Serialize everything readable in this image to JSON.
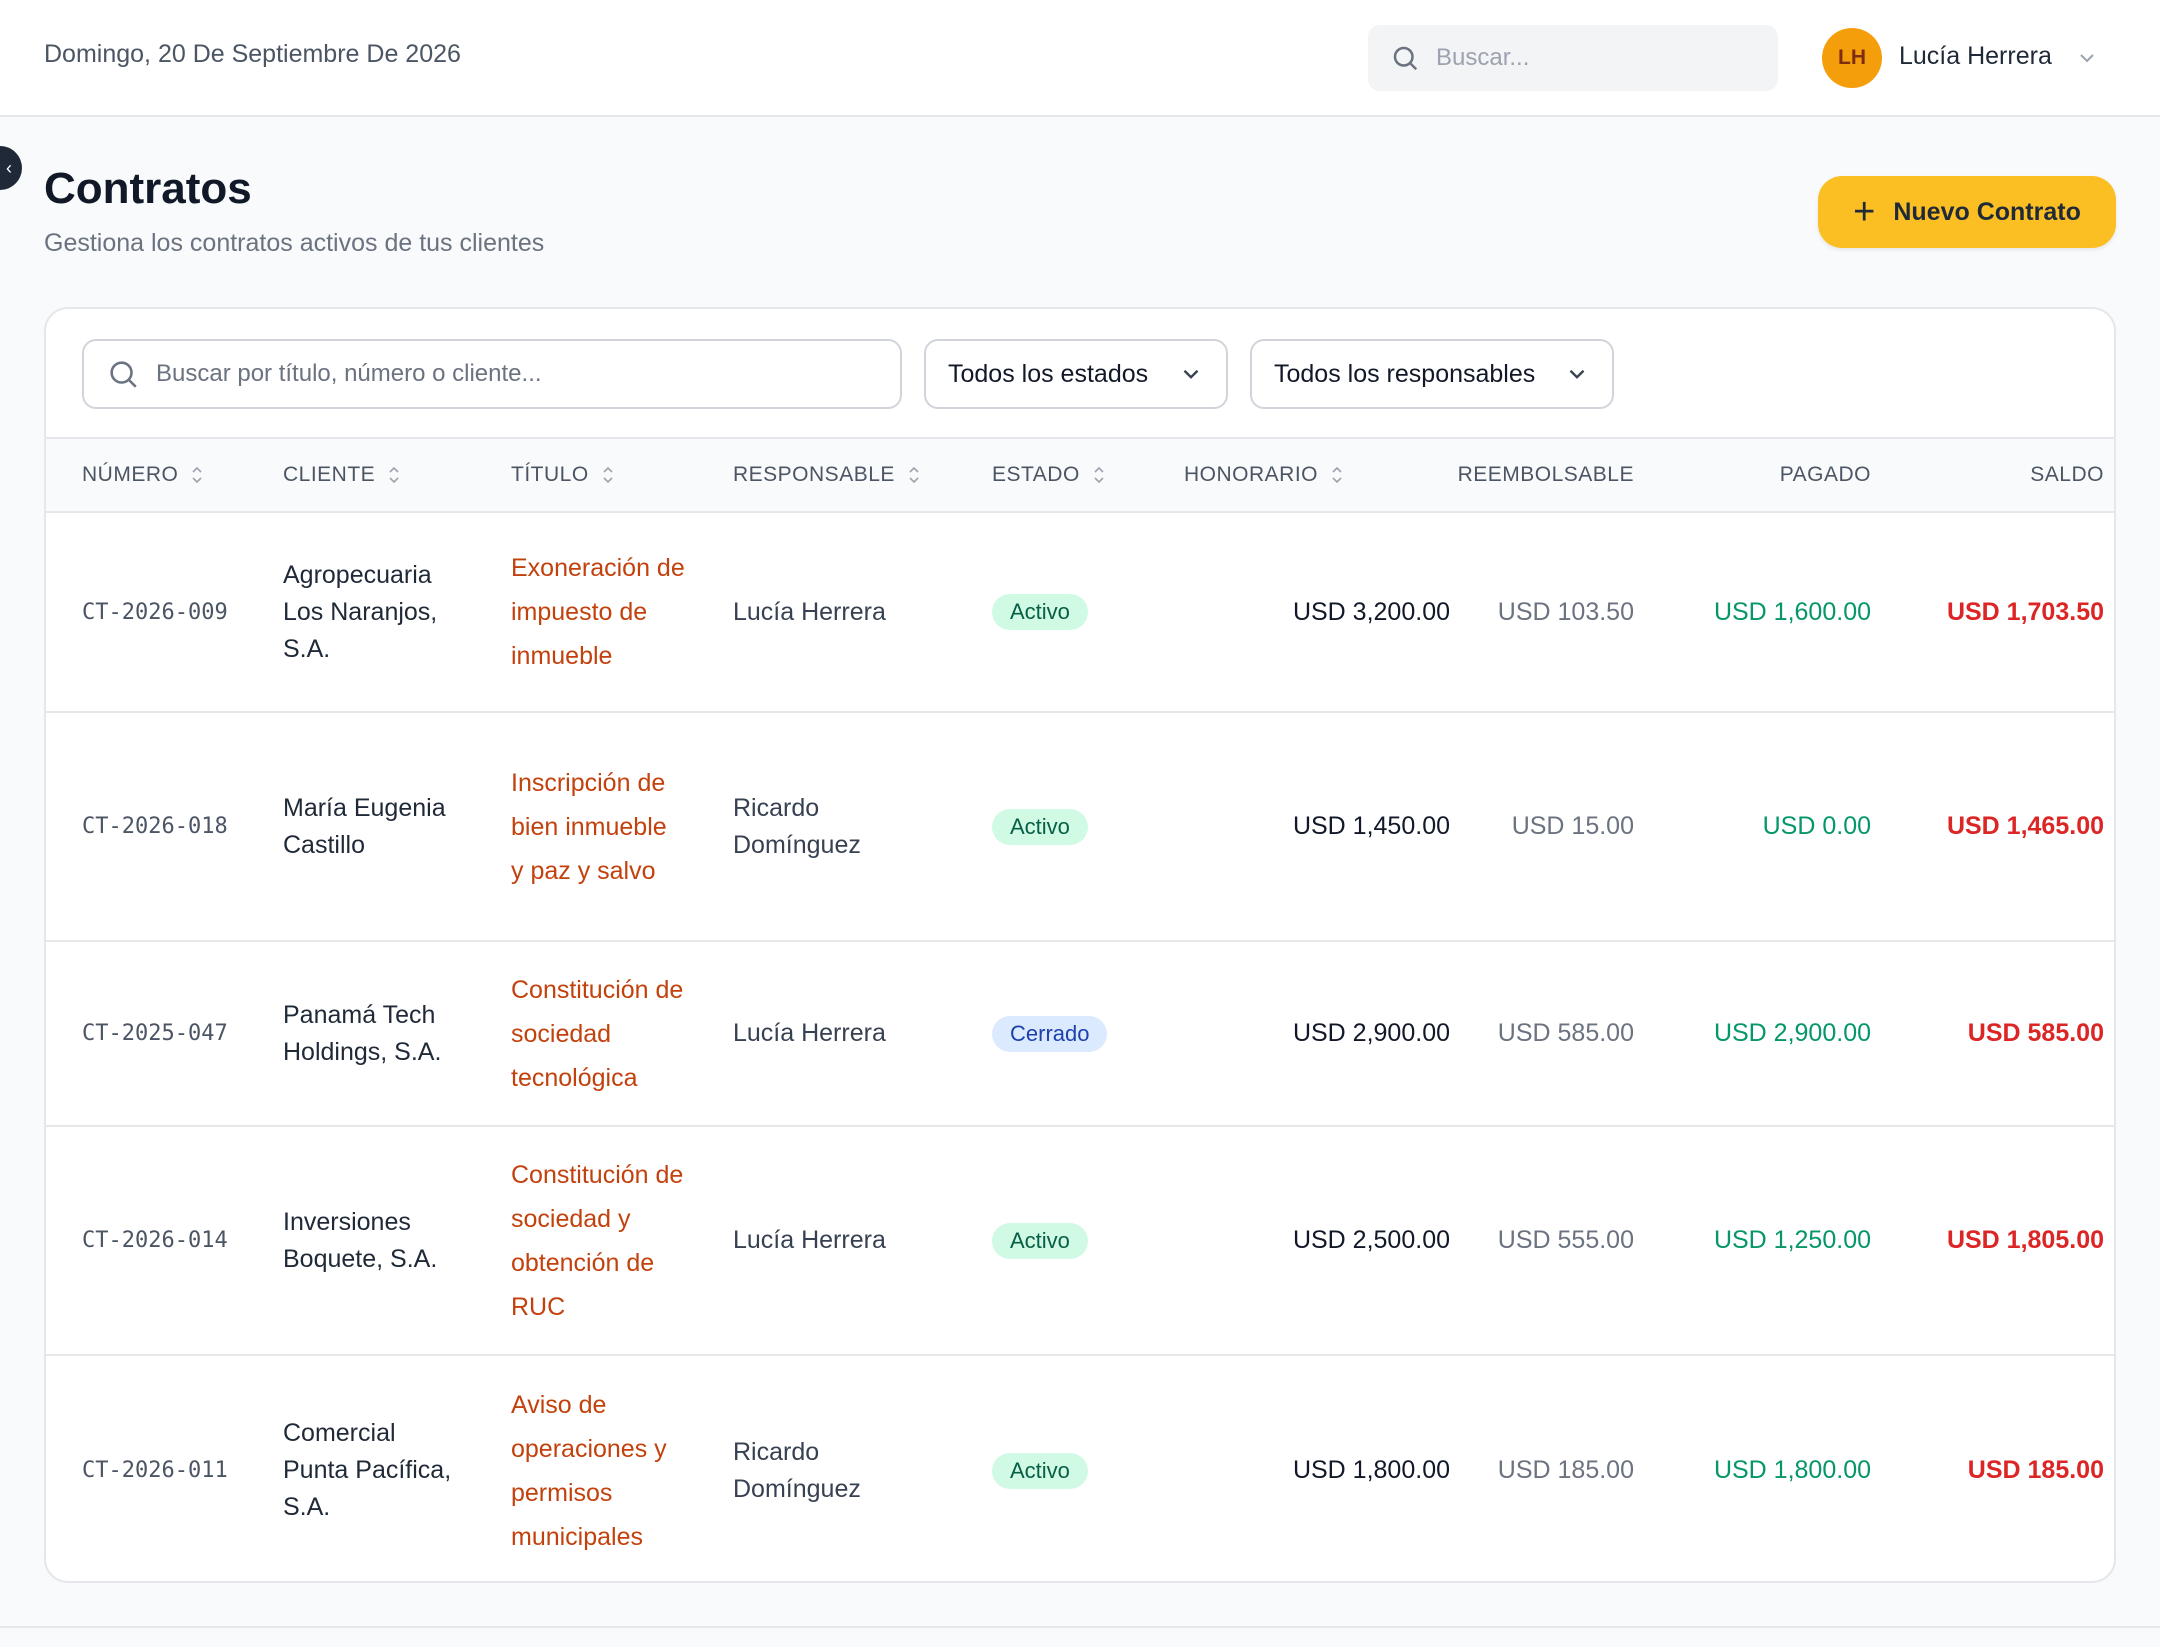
{
  "header": {
    "date": "Domingo, 20 De Septiembre De 2026",
    "search_placeholder": "Buscar...",
    "user_initials": "LH",
    "user_name": "Lucía Herrera"
  },
  "page": {
    "title": "Contratos",
    "subtitle": "Gestiona los contratos activos de tus clientes",
    "new_button": "Nuevo Contrato"
  },
  "filters": {
    "search_placeholder": "Buscar por título, número o cliente...",
    "estado": "Todos los estados",
    "responsable": "Todos los responsables"
  },
  "table": {
    "columns": [
      "NÚMERO",
      "CLIENTE",
      "TÍTULO",
      "RESPONSABLE",
      "ESTADO",
      "HONORARIO",
      "REEMBOLSABLE",
      "PAGADO",
      "SALDO"
    ],
    "rows": [
      {
        "numero": "CT-2026-009",
        "cliente": "Agropecuaria Los Naranjos, S.A.",
        "titulo": "Exoneración de impuesto de inmueble",
        "responsable": "Lucía Herrera",
        "estado": "Activo",
        "honorario": "USD 3,200.00",
        "reembolsable": "USD 103.50",
        "pagado": "USD 1,600.00",
        "saldo": "USD 1,703.50"
      },
      {
        "numero": "CT-2026-018",
        "cliente": "María Eugenia Castillo",
        "titulo": "Inscripción de bien inmueble y paz y salvo",
        "responsable": "Ricardo Domínguez",
        "estado": "Activo",
        "honorario": "USD 1,450.00",
        "reembolsable": "USD 15.00",
        "pagado": "USD 0.00",
        "saldo": "USD 1,465.00"
      },
      {
        "numero": "CT-2025-047",
        "cliente": "Panamá Tech Holdings, S.A.",
        "titulo": "Constitución de sociedad tecnológica",
        "responsable": "Lucía Herrera",
        "estado": "Cerrado",
        "honorario": "USD 2,900.00",
        "reembolsable": "USD 585.00",
        "pagado": "USD 2,900.00",
        "saldo": "USD 585.00"
      },
      {
        "numero": "CT-2026-014",
        "cliente": "Inversiones Boquete, S.A.",
        "titulo": "Constitución de sociedad y obtención de RUC",
        "responsable": "Lucía Herrera",
        "estado": "Activo",
        "honorario": "USD 2,500.00",
        "reembolsable": "USD 555.00",
        "pagado": "USD 1,250.00",
        "saldo": "USD 1,805.00"
      },
      {
        "numero": "CT-2026-011",
        "cliente": "Comercial Punta Pacífica, S.A.",
        "titulo": "Aviso de operaciones y permisos municipales",
        "responsable": "Ricardo Domínguez",
        "estado": "Activo",
        "honorario": "USD 1,800.00",
        "reembolsable": "USD 185.00",
        "pagado": "USD 1,800.00",
        "saldo": "USD 185.00"
      }
    ]
  }
}
